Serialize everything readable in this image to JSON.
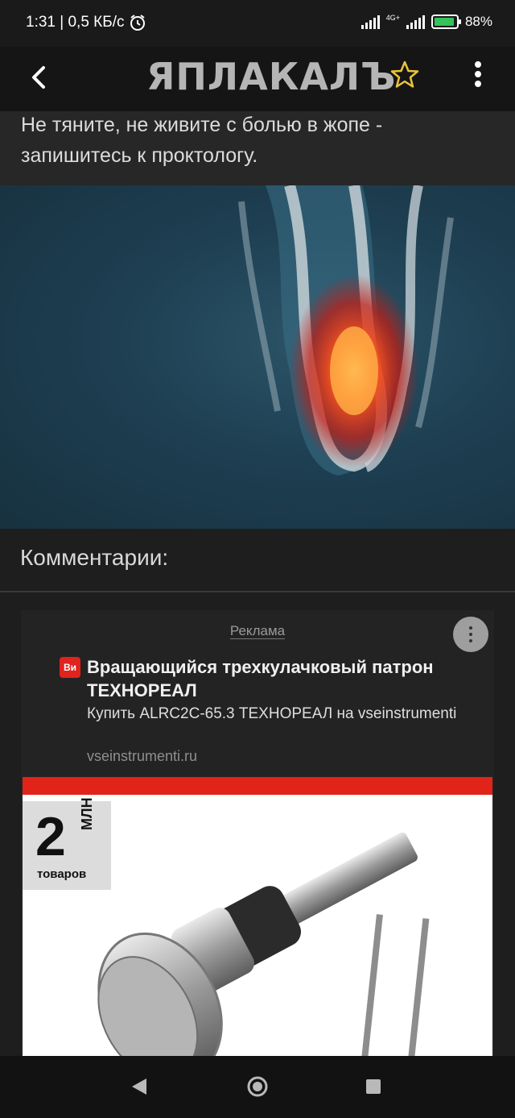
{
  "status_bar": {
    "time_speed": "1:31 | 0,5 КБ/с",
    "network": "4G+",
    "battery": "88%"
  },
  "header": {
    "logo_text": "ЯПЛАКАЛЪ"
  },
  "post": {
    "text": "Не тяните, не живите с болью в жопе - запишитесь к проктологу."
  },
  "comments": {
    "title": "Комментарии:"
  },
  "ad": {
    "label": "Реклама",
    "favicon": "Ви",
    "title": "Вращающийся трехкулачковый патрон ТЕХНОРЕАЛ",
    "description": "Купить ALRC2C-65.3 ТЕХНОРЕАЛ на vseinstrumenti",
    "domain": "vseinstrumenti.ru",
    "badge_number": "2",
    "badge_unit": "МЛН",
    "badge_goods": "товаров"
  },
  "colors": {
    "accent_star": "#e8c53a",
    "ad_red": "#e2231a"
  }
}
